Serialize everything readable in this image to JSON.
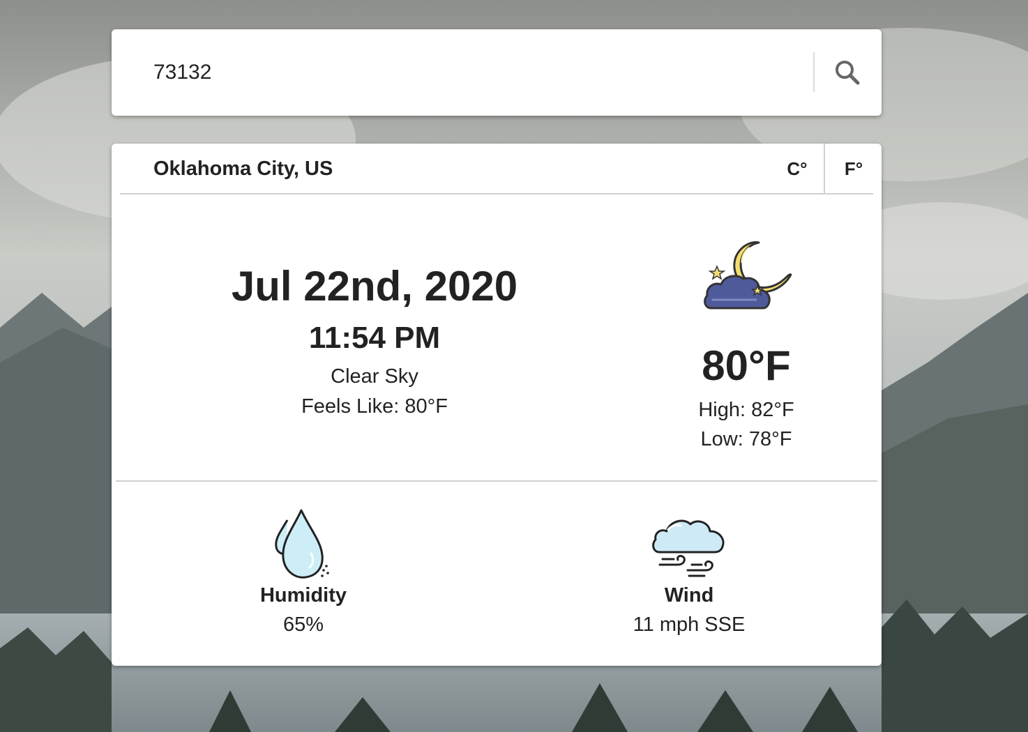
{
  "search": {
    "value": "73132"
  },
  "location": "Oklahoma City, US",
  "units": {
    "celsius": "C°",
    "fahrenheit": "F°"
  },
  "current": {
    "date": "Jul 22nd, 2020",
    "time": "11:54 PM",
    "condition": "Clear Sky",
    "feels_like": "Feels Like: 80°F",
    "temperature": "80°F",
    "high": "High: 82°F",
    "low": "Low: 78°F",
    "icon": "night-cloud-moon-icon"
  },
  "details": {
    "humidity": {
      "label": "Humidity",
      "value": "65%",
      "icon": "humidity-drops-icon"
    },
    "wind": {
      "label": "Wind",
      "value": "11 mph SSE",
      "icon": "wind-cloud-icon"
    }
  },
  "colors": {
    "cloud_dark": "#4f5a9a",
    "moon": "#f5dd6f",
    "drop": "#cdeef6",
    "cloud_light": "#cfeaf7"
  }
}
